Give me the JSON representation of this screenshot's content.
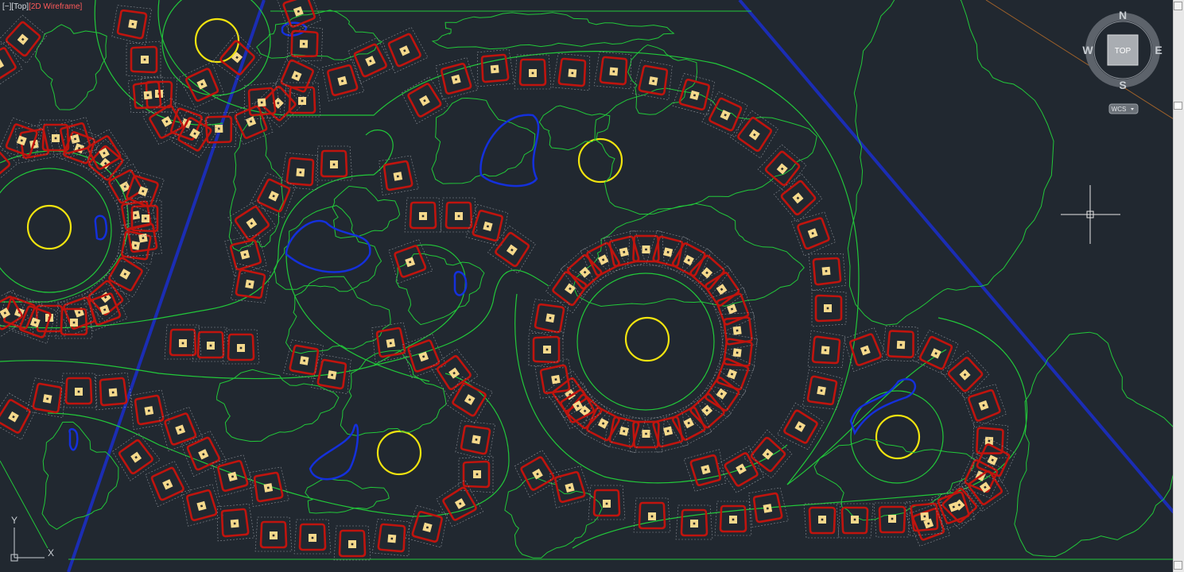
{
  "viewport": {
    "controls_label": "[−]",
    "view_label": "[Top]",
    "style_label": "[2D Wireframe]"
  },
  "viewcube": {
    "face_label": "TOP",
    "north": "N",
    "south": "S",
    "east": "E",
    "west": "W",
    "wcs_label": "WCS"
  },
  "ucs": {
    "x_label": "X",
    "y_label": "Y"
  },
  "colors": {
    "background": "#212830",
    "contour_green": "#22c83a",
    "boundary_blue": "#1b2db4",
    "lot_red": "#c0140e",
    "lot_outline": "#8a8f96",
    "pad_yellow": "#f5d98c",
    "circle_yellow": "#f2e40f",
    "water_blue": "#1430dc"
  }
}
